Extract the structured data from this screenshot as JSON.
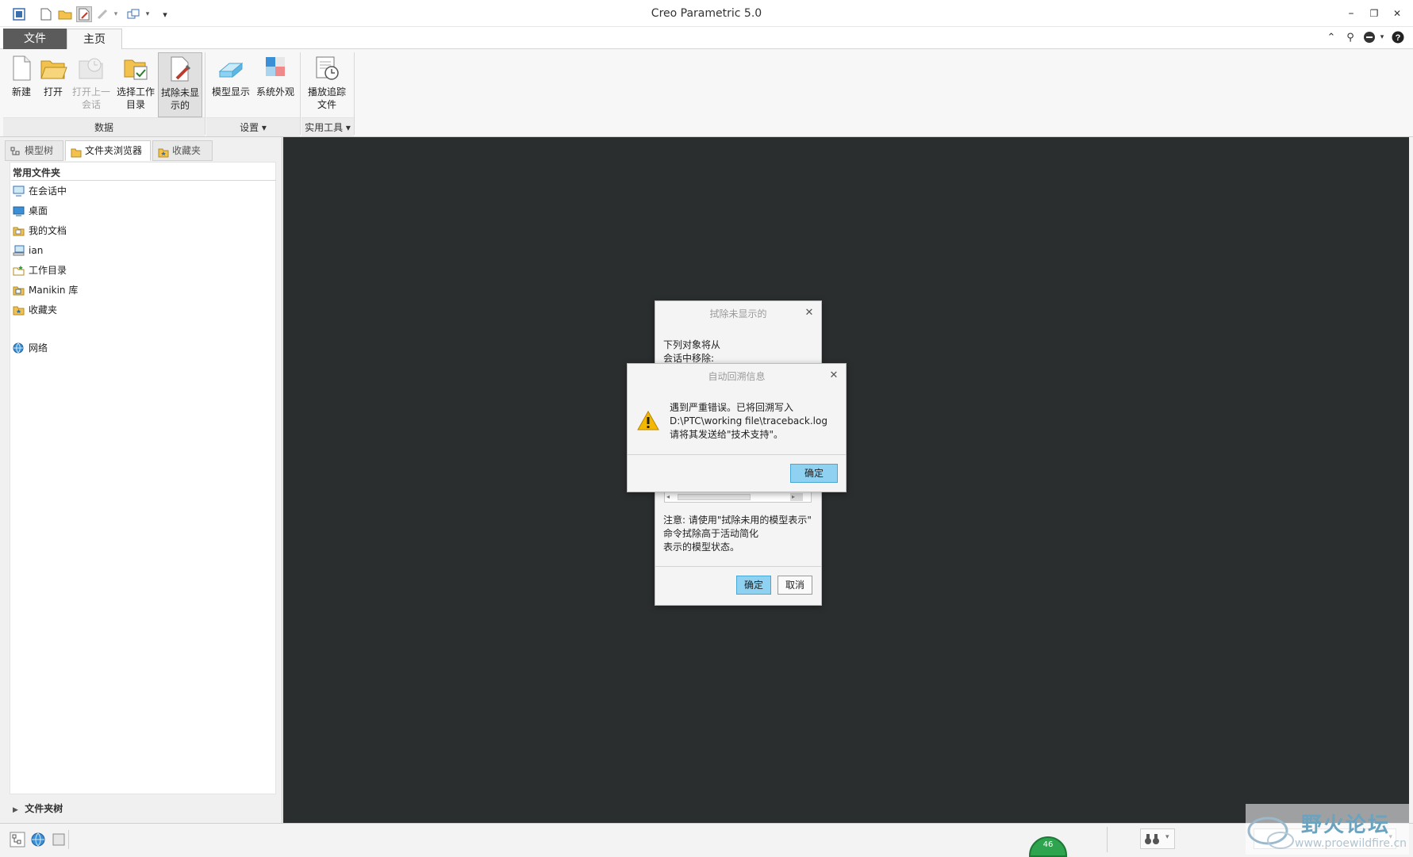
{
  "window": {
    "title": "Creo Parametric 5.0",
    "minimize": "–",
    "maximize": "❐",
    "close": "✕"
  },
  "quick_access": {
    "overflow": "▾"
  },
  "ribbon_tabs": {
    "file": "文件",
    "home": "主页"
  },
  "right_toolbar": {
    "collapse": "⌃",
    "search": "⚲",
    "help": "?"
  },
  "ribbon": {
    "buttons": {
      "new": "新建",
      "open": "打开",
      "open_last_1": "打开上一",
      "open_last_2": "会话",
      "select_dir_1": "选择工作",
      "select_dir_2": "目录",
      "erase_1": "拭除未显",
      "erase_2": "示的",
      "model_display": "模型显示",
      "system_appearance": "系统外观",
      "playback_1": "播放追踪",
      "playback_2": "文件"
    },
    "groups": {
      "data": "数据",
      "settings": "设置",
      "utilities": "实用工具"
    }
  },
  "left_panel": {
    "tabs": {
      "model_tree": "模型树",
      "folder_browser": "文件夹浏览器",
      "favorites": "收藏夹"
    },
    "common_folders_title": "常用文件夹",
    "folders": {
      "in_session": "在会话中",
      "desktop": "桌面",
      "my_docs": "我的文档",
      "ian": "ian",
      "working_dir": "工作目录",
      "manikin": "Manikin 库",
      "favorites": "收藏夹",
      "network": "网络"
    },
    "folder_tree": "文件夹树"
  },
  "dialog_erase": {
    "title": "拭除未显示的",
    "line1": "下列对象将从",
    "line2": "会话中移除:",
    "note1": "注意: 请使用\"拭除未用的模型表示\"",
    "note2": "命令拭除高于活动简化",
    "note3": "表示的模型状态。",
    "ok": "确定",
    "cancel": "取消"
  },
  "dialog_traceback": {
    "title": "自动回溯信息",
    "line1": "遇到严重错误。已将回溯写入",
    "line2": "D:\\PTC\\working file\\traceback.log",
    "line3": "请将其发送给\"技术支持\"。",
    "ok": "确定"
  },
  "status": {
    "counter": "46"
  },
  "watermark": {
    "brand": "野火论坛",
    "url": "www.proewildfire.cn"
  }
}
